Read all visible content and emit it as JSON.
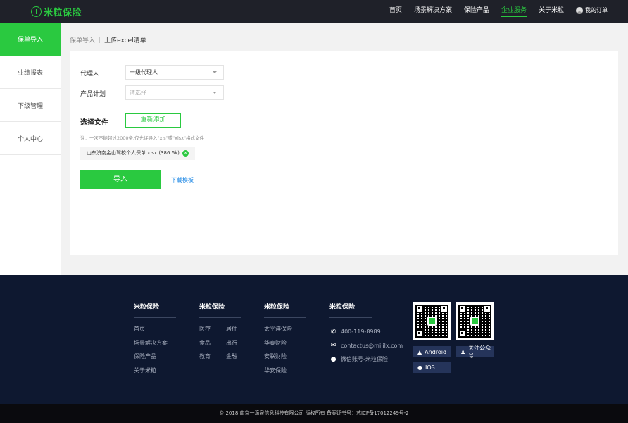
{
  "header": {
    "logo_text": "米粒保险",
    "nav": [
      "首页",
      "场景解决方案",
      "保险产品",
      "企业服务",
      "关于米粒"
    ],
    "active_nav": "企业服务",
    "orders_label": "我的订单"
  },
  "sidebar": {
    "items": [
      {
        "label": "保单导入",
        "active": true
      },
      {
        "label": "业绩报表",
        "active": false
      },
      {
        "label": "下级管理",
        "active": false
      },
      {
        "label": "个人中心",
        "active": false
      }
    ]
  },
  "breadcrumb": {
    "parent": "保单导入",
    "separator": "|",
    "current": "上传excel清单"
  },
  "form": {
    "agent_label": "代理人",
    "agent_value": "一级代理人",
    "plan_label": "产品计划",
    "plan_placeholder": "请选择",
    "file_section_title": "选择文件",
    "readd_button": "重新添加",
    "note": "注：一次不能超过2000条,仅允许导入\"xls\"或\"xlsx\"格式文件",
    "file_name": "山东济南金山驾校个人保单.xlsx (386.6k)",
    "import_button": "导入",
    "download_link": "下载模板"
  },
  "footer": {
    "col1": {
      "title": "米粒保险",
      "links": [
        "首页",
        "场景解决方案",
        "保险产品",
        "关于米粒"
      ]
    },
    "col2": {
      "title": "米粒保险",
      "links": [
        [
          "医疗",
          "居住"
        ],
        [
          "食品",
          "出行"
        ],
        [
          "教育",
          "金融"
        ]
      ]
    },
    "col3": {
      "title": "米粒保险",
      "links": [
        "太平洋保险",
        "华泰财险",
        "安联财险",
        "华安保险"
      ]
    },
    "col4": {
      "title": "米粒保险",
      "phone": "400-119-8989",
      "email": "contactus@mililx.com",
      "wechat": "微信账号-米粒保险"
    },
    "apps": {
      "android": "Android",
      "follow": "关注公众号",
      "ios": "IOS"
    },
    "copyright": "© 2018 南京一滴泉信息科技有限公司 版权所有 备案证书号：苏ICP备17012249号-2"
  },
  "colors": {
    "brand_green": "#2ac940",
    "topbar_bg": "#1f2129",
    "footer_bg": "#0e1830"
  }
}
